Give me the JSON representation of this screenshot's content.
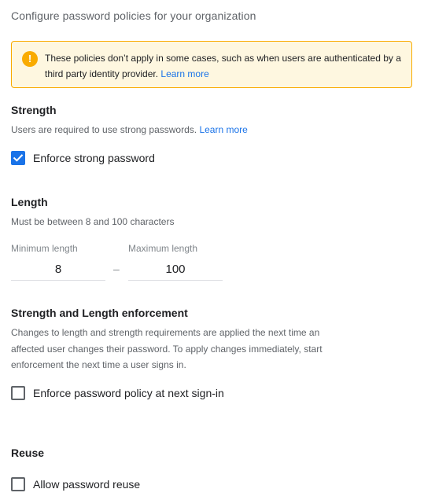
{
  "page": {
    "heading": "Configure password policies for your organization"
  },
  "warning": {
    "icon": "info-icon",
    "icon_glyph": "!",
    "text": "These policies don’t apply in some cases, such as when users are authenticated by a third party identity provider. ",
    "link": "Learn more"
  },
  "strength": {
    "title": "Strength",
    "description": "Users are required to use strong passwords. ",
    "link": "Learn more",
    "checkbox_label": "Enforce strong password",
    "checked": true
  },
  "length": {
    "title": "Length",
    "description": "Must be between 8 and 100 characters",
    "min_label": "Minimum length",
    "min_value": "8",
    "separator": "–",
    "max_label": "Maximum length",
    "max_value": "100"
  },
  "enforcement": {
    "title": "Strength and Length enforcement",
    "description_lines": [
      "Changes to length and strength requirements are applied the next time an",
      "affected user changes their password. To apply changes immediately, start",
      "enforcement the next time a user signs in."
    ],
    "checkbox_label": "Enforce password policy at next sign-in",
    "checked": false
  },
  "reuse": {
    "title": "Reuse",
    "checkbox_label": "Allow password reuse",
    "checked": false
  },
  "colors": {
    "accent": "#1a73e8",
    "warning_bg": "#fef7e0",
    "warning_border": "#f9ab00"
  }
}
